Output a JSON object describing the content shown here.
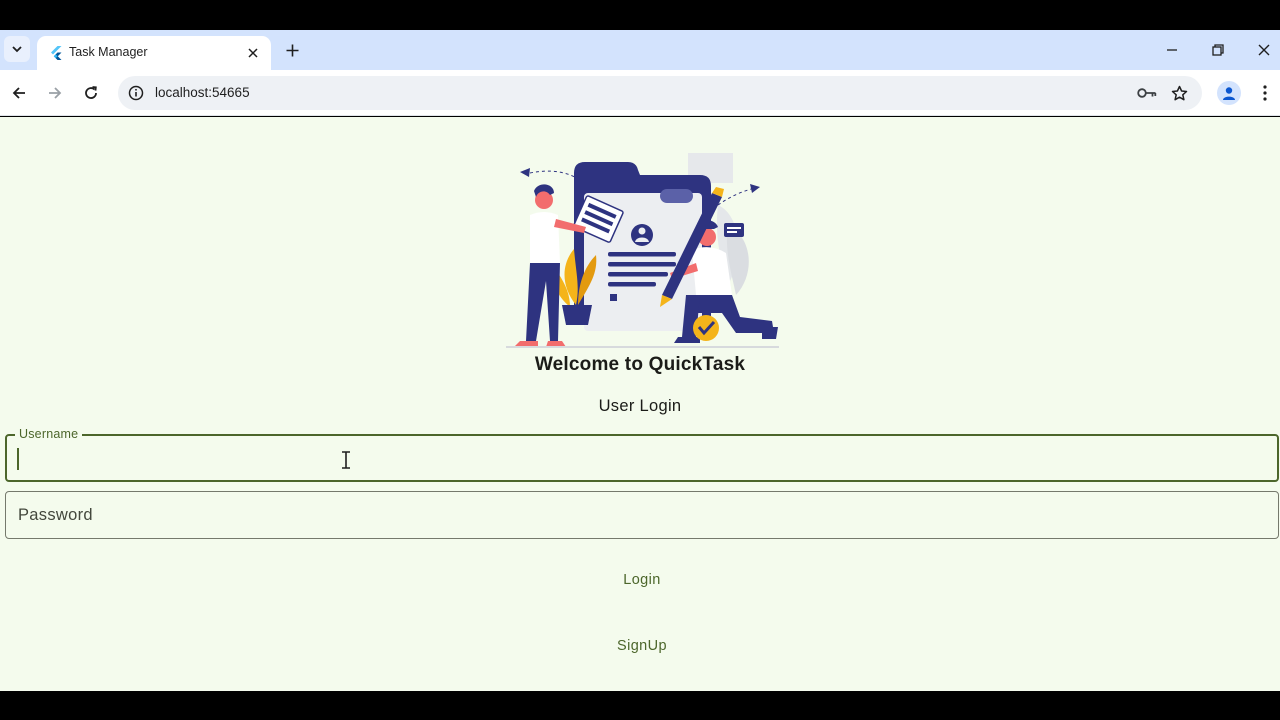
{
  "browser": {
    "tab": {
      "title": "Task Manager",
      "favicon": "flutter-icon"
    },
    "address": {
      "url": "localhost:54665"
    },
    "icons": {
      "tab_search": "chevron-down-icon",
      "tab_close": "close-icon",
      "new_tab": "plus-icon",
      "minimize": "minimize-icon",
      "restore": "restore-icon",
      "close_window": "close-icon",
      "back": "back-arrow-icon",
      "forward": "forward-arrow-icon",
      "reload": "reload-icon",
      "site_info": "info-icon",
      "password_key": "key-icon",
      "bookmark": "star-icon",
      "profile": "profile-icon",
      "menu": "kebab-menu-icon"
    }
  },
  "app": {
    "title": "Welcome to QuickTask",
    "subtitle": "User Login",
    "username": {
      "label": "Username",
      "value": ""
    },
    "password": {
      "placeholder": "Password"
    },
    "login_label": "Login",
    "signup_label": "SignUp",
    "colors": {
      "background": "#f4fbed",
      "primary": "#4c662b",
      "text": "#1b1c18",
      "illustration_navy": "#2e3380",
      "illustration_coral": "#f26d6d",
      "illustration_gold": "#f4b41a"
    }
  }
}
